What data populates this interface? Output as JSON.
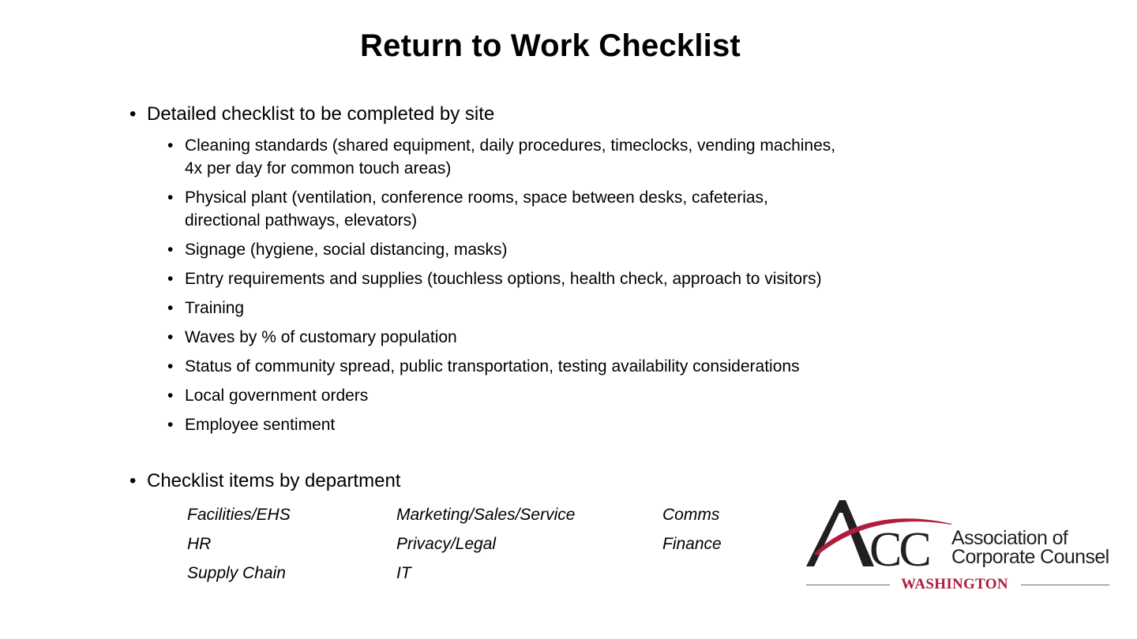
{
  "slide": {
    "title": "Return to Work Checklist",
    "bullet_glyph": "•",
    "section1": {
      "heading": "Detailed checklist to be completed by site",
      "items": [
        {
          "line1": "Cleaning standards (shared equipment, daily procedures, timeclocks, vending machines,",
          "line2": "4x per day for common touch areas)"
        },
        {
          "line1": "Physical plant (ventilation, conference rooms, space between desks, cafeterias,",
          "line2": "directional pathways, elevators)"
        },
        {
          "line1": "Signage (hygiene, social distancing, masks)"
        },
        {
          "line1": "Entry requirements and supplies (touchless options, health check, approach to visitors)"
        },
        {
          "line1": "Training"
        },
        {
          "line1": "Waves by % of customary population"
        },
        {
          "line1": "Status of community spread, public transportation, testing availability considerations"
        },
        {
          "line1": "Local government orders"
        },
        {
          "line1": "Employee sentiment"
        }
      ]
    },
    "section2": {
      "heading": "Checklist items by department",
      "columns": [
        [
          "Facilities/EHS",
          "HR",
          "Supply Chain"
        ],
        [
          "Marketing/Sales/Service",
          "Privacy/Legal",
          "IT"
        ],
        [
          "Comms",
          "Finance"
        ]
      ]
    }
  },
  "logo": {
    "icon": "acc-logo-icon",
    "letters": "ACC",
    "name_line1": "Association of",
    "name_line2": "Corporate Counsel",
    "region": "WASHINGTON",
    "colors": {
      "dark": "#231f20",
      "accent": "#b01c3c",
      "rule": "#6d6e71"
    }
  }
}
